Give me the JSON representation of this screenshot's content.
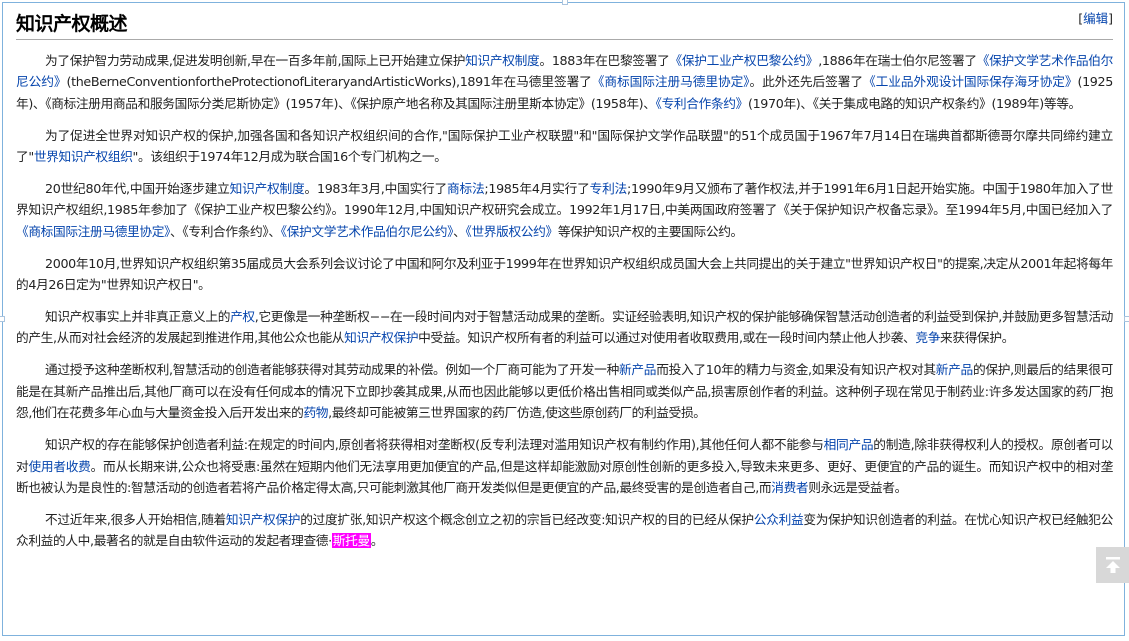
{
  "section": {
    "title": "知识产权概述",
    "edit_bracket_open": "[",
    "edit_label": "编辑",
    "edit_bracket_close": "]"
  },
  "paragraphs": [
    {
      "segments": [
        {
          "t": "为了保护智力劳动成果,促进发明创新,早在一百多年前,国际上已开始建立保护"
        },
        {
          "t": "知识产权制度",
          "link": true
        },
        {
          "t": "。1883年在巴黎签署了"
        },
        {
          "t": "《保护工业产权巴黎公约》",
          "link": true
        },
        {
          "t": ",1886年在瑞士伯尔尼签署了"
        },
        {
          "t": "《保护文学艺术作品伯尔尼公约》",
          "link": true
        },
        {
          "t": "(theBerneConventionfortheProtectionofLiteraryandArtisticWorks),1891年在马德里签署了"
        },
        {
          "t": "《商标国际注册马德里协定》",
          "link": true
        },
        {
          "t": "。此外还先后签署了"
        },
        {
          "t": "《工业品外观设计国际保存海牙协定》",
          "link": true
        },
        {
          "t": "(1925年)、《商标注册用商品和服务国际分类尼斯协定》(1957年)、《保护原产地名称及其国际注册里斯本协定》(1958年)、"
        },
        {
          "t": "《专利合作条约》",
          "link": true
        },
        {
          "t": "(1970年)、《关于集成电路的知识产权条约》(1989年)等等。"
        }
      ]
    },
    {
      "segments": [
        {
          "t": "为了促进全世界对知识产权的保护,加强各国和各知识产权组织间的合作,\"国际保护工业产权联盟\"和\"国际保护文学作品联盟\"的51个成员国于1967年7月14日在瑞典首都斯德哥尔摩共同缔约建立了\""
        },
        {
          "t": "世界知识产权组织",
          "link": true
        },
        {
          "t": "\"。该组织于1974年12月成为联合国16个专门机构之一。"
        }
      ]
    },
    {
      "segments": [
        {
          "t": "20世纪80年代,中国开始逐步建立"
        },
        {
          "t": "知识产权制度",
          "link": true
        },
        {
          "t": "。1983年3月,中国实行了"
        },
        {
          "t": "商标法",
          "link": true
        },
        {
          "t": ";1985年4月实行了"
        },
        {
          "t": "专利法",
          "link": true
        },
        {
          "t": ";1990年9月又颁布了著作权法,并于1991年6月1日起开始实施。中国于1980年加入了世界知识产权组织,1985年参加了《保护工业产权巴黎公约》。1990年12月,中国知识产权研究会成立。1992年1月17日,中美两国政府签署了《关于保护知识产权备忘录》。至1994年5月,中国已经加入了"
        },
        {
          "t": "《商标国际注册马德里协定》",
          "link": true
        },
        {
          "t": "、《专利合作条约》、"
        },
        {
          "t": "《保护文学艺术作品伯尔尼公约》",
          "link": true
        },
        {
          "t": "、"
        },
        {
          "t": "《世界版权公约》",
          "link": true
        },
        {
          "t": "等保护知识产权的主要国际公约。"
        }
      ]
    },
    {
      "segments": [
        {
          "t": "2000年10月,世界知识产权组织第35届成员大会系列会议讨论了中国和阿尔及利亚于1999年在世界知识产权组织成员国大会上共同提出的关于建立\"世界知识产权日\"的提案,决定从2001年起将每年的4月26日定为\"世界知识产权日\"。"
        }
      ]
    },
    {
      "segments": [
        {
          "t": "知识产权事实上并非真正意义上的"
        },
        {
          "t": "产权",
          "link": true
        },
        {
          "t": ",它更像是一种垄断权−−在一段时间内对于智慧活动成果的垄断。实证经验表明,知识产权的保护能够确保智慧活动创造者的利益受到保护,并鼓励更多智慧活动的产生,从而对社会经济的发展起到推进作用,其他公众也能从"
        },
        {
          "t": "知识产权保护",
          "link": true
        },
        {
          "t": "中受益。知识产权所有者的利益可以通过对使用者收取费用,或在一段时间内禁止他人抄袭、"
        },
        {
          "t": "竞争",
          "link": true
        },
        {
          "t": "来获得保护。"
        }
      ]
    },
    {
      "segments": [
        {
          "t": "通过授予这种垄断权利,智慧活动的创造者能够获得对其劳动成果的补偿。例如一个厂商可能为了开发一种"
        },
        {
          "t": "新产品",
          "link": true
        },
        {
          "t": "而投入了10年的精力与资金,如果没有知识产权对其"
        },
        {
          "t": "新产品",
          "link": true
        },
        {
          "t": "的保护,则最后的结果很可能是在其新产品推出后,其他厂商可以在没有任何成本的情况下立即抄袭其成果,从而也因此能够以更低价格出售相同或类似产品,损害原创作者的利益。这种例子现在常见于制药业:许多发达国家的药厂抱怨,他们在花费多年心血与大量资金投入后开发出来的"
        },
        {
          "t": "药物",
          "link": true
        },
        {
          "t": ",最终却可能被第三世界国家的药厂仿造,使这些原创药厂的利益受损。"
        }
      ]
    },
    {
      "segments": [
        {
          "t": "知识产权的存在能够保护创造者利益:在规定的时间内,原创者将获得相对垄断权(反专利法理对滥用知识产权有制约作用),其他任何人都不能参与"
        },
        {
          "t": "相同产品",
          "link": true
        },
        {
          "t": "的制造,除非获得权利人的授权。原创者可以对"
        },
        {
          "t": "使用者收费",
          "link": true
        },
        {
          "t": "。而从长期来讲,公众也将受惠:虽然在短期内他们无法享用更加便宜的产品,但是这样却能激励对原创性创新的更多投入,导致未来更多、更好、更便宜的产品的诞生。而知识产权中的相对垄断也被认为是良性的:智慧活动的创造者若将产品价格定得太高,只可能刺激其他厂商开发类似但是更便宜的产品,最终受害的是创造者自己,而"
        },
        {
          "t": "消费者",
          "link": true
        },
        {
          "t": "则永远是受益者。"
        }
      ]
    },
    {
      "segments": [
        {
          "t": "不过近年来,很多人开始相信,随着"
        },
        {
          "t": "知识产权保护",
          "link": true
        },
        {
          "t": "的过度扩张,知识产权这个概念创立之初的宗旨已经改变:知识产权的目的已经从保护"
        },
        {
          "t": "公众利益",
          "link": true
        },
        {
          "t": "变为保护知识创造者的利益。在忧心知识产权已经触犯公众利益的人中,最著名的就是自由软件运动的发起者理查德·"
        },
        {
          "t": "斯托曼",
          "link": true,
          "highlight": true
        },
        {
          "t": "。"
        }
      ]
    }
  ],
  "scroll_top_button": {
    "icon": "arrow-up-to-top-icon"
  },
  "colors": {
    "link": "#0645ad",
    "highlight": "#ff00ff",
    "border": "#7fb2dd"
  }
}
